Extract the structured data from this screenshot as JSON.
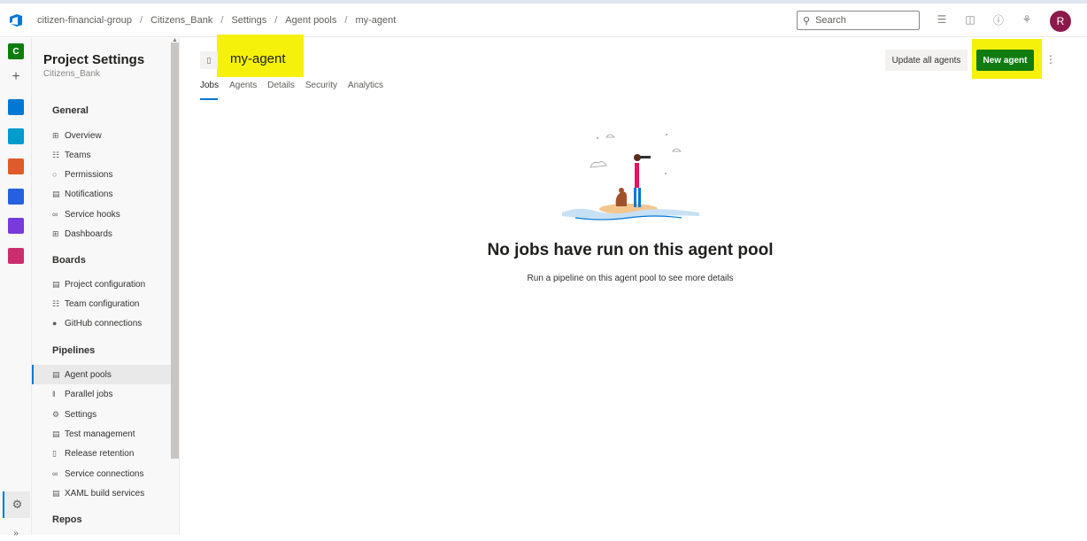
{
  "breadcrumb": [
    "citizen-financial-group",
    "Citizens_Bank",
    "Settings",
    "Agent pools",
    "my-agent"
  ],
  "search": {
    "placeholder": "Search"
  },
  "user": {
    "initial": "R"
  },
  "rail": {
    "org_letter": "C"
  },
  "nav": {
    "title": "Project Settings",
    "subtitle": "Citizens_Bank",
    "sections": {
      "general": "General",
      "boards": "Boards",
      "pipelines": "Pipelines",
      "repos": "Repos"
    },
    "general_items": [
      "Overview",
      "Teams",
      "Permissions",
      "Notifications",
      "Service hooks",
      "Dashboards"
    ],
    "boards_items": [
      "Project configuration",
      "Team configuration",
      "GitHub connections"
    ],
    "pipelines_items": [
      "Agent pools",
      "Parallel jobs",
      "Settings",
      "Test management",
      "Release retention",
      "Service connections",
      "XAML build services"
    ]
  },
  "page": {
    "title": "my-agent",
    "tabs": [
      "Jobs",
      "Agents",
      "Details",
      "Security",
      "Analytics"
    ],
    "active_tab": "Jobs",
    "update_button": "Update all agents",
    "new_button": "New agent",
    "empty_title": "No jobs have run on this agent pool",
    "empty_subtitle": "Run a pipeline on this agent pool to see more details"
  },
  "colors": {
    "accent": "#0078d4",
    "new_button": "#107c10",
    "highlight": "#f5f10a",
    "avatar": "#8b1a4a"
  }
}
